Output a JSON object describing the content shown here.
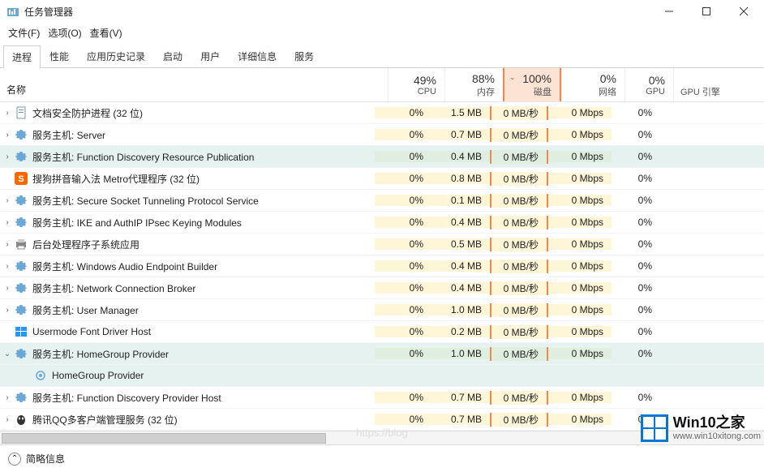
{
  "window": {
    "title": "任务管理器",
    "menu": {
      "file": "文件(F)",
      "options": "选项(O)",
      "view": "查看(V)"
    },
    "tabs": [
      "进程",
      "性能",
      "应用历史记录",
      "启动",
      "用户",
      "详细信息",
      "服务"
    ]
  },
  "columns": {
    "name": "名称",
    "cpu": {
      "pct": "49%",
      "label": "CPU"
    },
    "mem": {
      "pct": "88%",
      "label": "内存"
    },
    "disk": {
      "pct": "100%",
      "label": "磁盘"
    },
    "net": {
      "pct": "0%",
      "label": "网络"
    },
    "gpu": {
      "pct": "0%",
      "label": "GPU"
    },
    "gpue": {
      "label": "GPU 引擎"
    }
  },
  "rows": [
    {
      "icon": "doc",
      "expand": ">",
      "name": "文档安全防护进程 (32 位)",
      "cpu": "0%",
      "mem": "1.5 MB",
      "disk": "0 MB/秒",
      "net": "0 Mbps",
      "gpu": "0%"
    },
    {
      "icon": "gear",
      "expand": ">",
      "name": "服务主机: Server",
      "cpu": "0%",
      "mem": "0.7 MB",
      "disk": "0 MB/秒",
      "net": "0 Mbps",
      "gpu": "0%"
    },
    {
      "icon": "gear",
      "expand": ">",
      "sel": true,
      "name": "服务主机: Function Discovery Resource Publication",
      "cpu": "0%",
      "mem": "0.4 MB",
      "disk": "0 MB/秒",
      "net": "0 Mbps",
      "gpu": "0%"
    },
    {
      "icon": "sogou",
      "expand": "",
      "name": "搜狗拼音输入法 Metro代理程序 (32 位)",
      "cpu": "0%",
      "mem": "0.8 MB",
      "disk": "0 MB/秒",
      "net": "0 Mbps",
      "gpu": "0%"
    },
    {
      "icon": "gear",
      "expand": ">",
      "name": "服务主机: Secure Socket Tunneling Protocol Service",
      "cpu": "0%",
      "mem": "0.1 MB",
      "disk": "0 MB/秒",
      "net": "0 Mbps",
      "gpu": "0%"
    },
    {
      "icon": "gear",
      "expand": ">",
      "name": "服务主机: IKE and AuthIP IPsec Keying Modules",
      "cpu": "0%",
      "mem": "0.4 MB",
      "disk": "0 MB/秒",
      "net": "0 Mbps",
      "gpu": "0%"
    },
    {
      "icon": "print",
      "expand": ">",
      "name": "后台处理程序子系统应用",
      "cpu": "0%",
      "mem": "0.5 MB",
      "disk": "0 MB/秒",
      "net": "0 Mbps",
      "gpu": "0%"
    },
    {
      "icon": "gear",
      "expand": ">",
      "name": "服务主机: Windows Audio Endpoint Builder",
      "cpu": "0%",
      "mem": "0.4 MB",
      "disk": "0 MB/秒",
      "net": "0 Mbps",
      "gpu": "0%"
    },
    {
      "icon": "gear",
      "expand": ">",
      "name": "服务主机: Network Connection Broker",
      "cpu": "0%",
      "mem": "0.4 MB",
      "disk": "0 MB/秒",
      "net": "0 Mbps",
      "gpu": "0%"
    },
    {
      "icon": "gear",
      "expand": ">",
      "name": "服务主机: User Manager",
      "cpu": "0%",
      "mem": "1.0 MB",
      "disk": "0 MB/秒",
      "net": "0 Mbps",
      "gpu": "0%"
    },
    {
      "icon": "win",
      "expand": "",
      "name": "Usermode Font Driver Host",
      "cpu": "0%",
      "mem": "0.2 MB",
      "disk": "0 MB/秒",
      "net": "0 Mbps",
      "gpu": "0%"
    },
    {
      "icon": "gear",
      "expand": "v",
      "sel": true,
      "name": "服务主机: HomeGroup Provider",
      "cpu": "0%",
      "mem": "1.0 MB",
      "disk": "0 MB/秒",
      "net": "0 Mbps",
      "gpu": "0%"
    },
    {
      "icon": "svc",
      "expand": "",
      "child": true,
      "sel": true,
      "name": "HomeGroup Provider",
      "cpu": "",
      "mem": "",
      "disk": "",
      "net": "",
      "gpu": ""
    },
    {
      "icon": "gear",
      "expand": ">",
      "name": "服务主机: Function Discovery Provider Host",
      "cpu": "0%",
      "mem": "0.7 MB",
      "disk": "0 MB/秒",
      "net": "0 Mbps",
      "gpu": "0%"
    },
    {
      "icon": "qq",
      "expand": ">",
      "name": "腾讯QQ多客户端管理服务 (32 位)",
      "cpu": "0%",
      "mem": "0.7 MB",
      "disk": "0 MB/秒",
      "net": "0 Mbps",
      "gpu": "0%"
    }
  ],
  "footer": {
    "brief": "简略信息"
  },
  "watermark": {
    "brand": "Win10之家",
    "url": "www.win10xitong.com"
  },
  "blogurl": "https://blog"
}
